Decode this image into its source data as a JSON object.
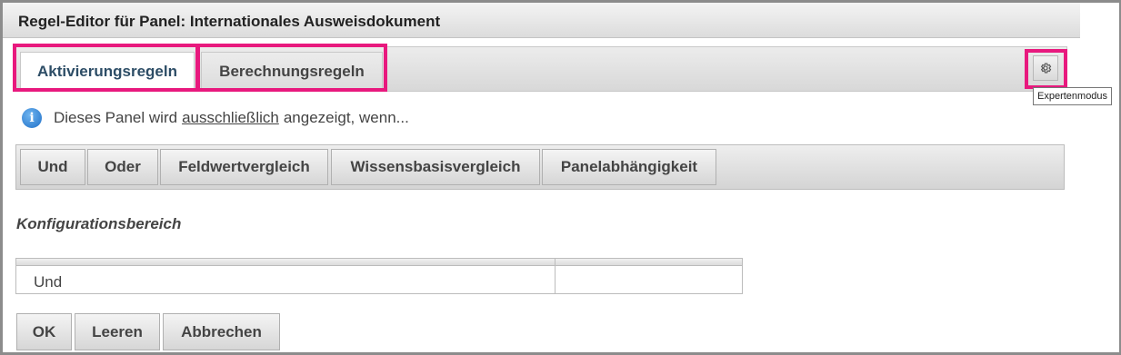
{
  "window": {
    "title": "Regel-Editor für Panel: Internationales Ausweisdokument"
  },
  "tabs": [
    {
      "label": "Aktivierungsregeln",
      "active": true
    },
    {
      "label": "Berechnungsregeln",
      "active": false
    }
  ],
  "expert_mode": {
    "icon": "gear-icon",
    "tooltip": "Expertenmodus"
  },
  "info": {
    "icon": "info-icon",
    "prefix": "Dieses Panel wird",
    "emphasis": "ausschließlich",
    "suffix": "angezeigt, wenn..."
  },
  "toolbar": {
    "buttons": [
      "Und",
      "Oder",
      "Feldwertvergleich",
      "Wissensbasisvergleich",
      "Panelabhängigkeit"
    ]
  },
  "config": {
    "title": "Konfigurationsbereich",
    "rows": [
      {
        "col1": "Und",
        "col2": ""
      }
    ]
  },
  "footer": {
    "ok": "OK",
    "clear": "Leeren",
    "cancel": "Abbrechen"
  },
  "colors": {
    "highlight": "#e8197e",
    "active_tab_text": "#2d4d66",
    "info_icon": "#1f6fc7"
  }
}
